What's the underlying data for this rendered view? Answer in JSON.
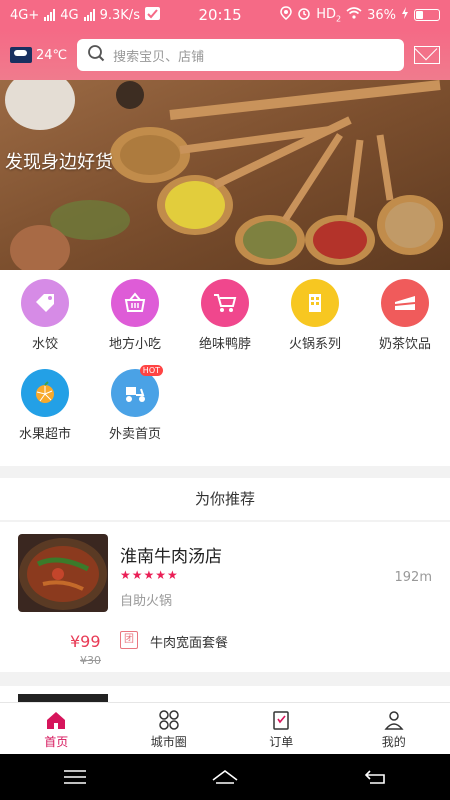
{
  "status_bar": {
    "network_left": "4G+",
    "network_mid": "4G",
    "speed": "9.3K/s",
    "time": "20:15",
    "hd_label": "HD",
    "hd_sub": "2",
    "battery_percent": "36%",
    "battery_level": 0.36
  },
  "header": {
    "weather_temp": "24℃",
    "search_placeholder": "搜索宝贝、店铺"
  },
  "banner": {
    "caption": "发现身边好货"
  },
  "categories": [
    {
      "label": "水饺",
      "icon": "tag-icon",
      "color": "#d68be6"
    },
    {
      "label": "地方小吃",
      "icon": "basket-icon",
      "color": "#de5cd7"
    },
    {
      "label": "绝味鸭脖",
      "icon": "cart-icon",
      "color": "#f0478d"
    },
    {
      "label": "火锅系列",
      "icon": "building-icon",
      "color": "#f7c721"
    },
    {
      "label": "奶茶饮品",
      "icon": "cake-icon",
      "color": "#f05b5b"
    },
    {
      "label": "水果超市",
      "icon": "orange-icon",
      "color": "#23a0e6"
    },
    {
      "label": "外卖首页",
      "icon": "scooter-icon",
      "color": "#4aa2e6",
      "badge": "HOT"
    }
  ],
  "recommend": {
    "title": "为你推荐",
    "store_name": "淮南牛肉汤店",
    "stars": "★★★★★",
    "distance": "192m",
    "tagline": "自助火锅",
    "price": "¥99",
    "old_price": "¥30",
    "group_badge": "团",
    "group_deal": "牛肉宽面套餐"
  },
  "bottom_nav": [
    {
      "label": "首页",
      "icon": "home-icon",
      "active": true
    },
    {
      "label": "城市圈",
      "icon": "grid-icon",
      "active": false
    },
    {
      "label": "订单",
      "icon": "clipboard-icon",
      "active": false
    },
    {
      "label": "我的",
      "icon": "user-icon",
      "active": false
    }
  ]
}
